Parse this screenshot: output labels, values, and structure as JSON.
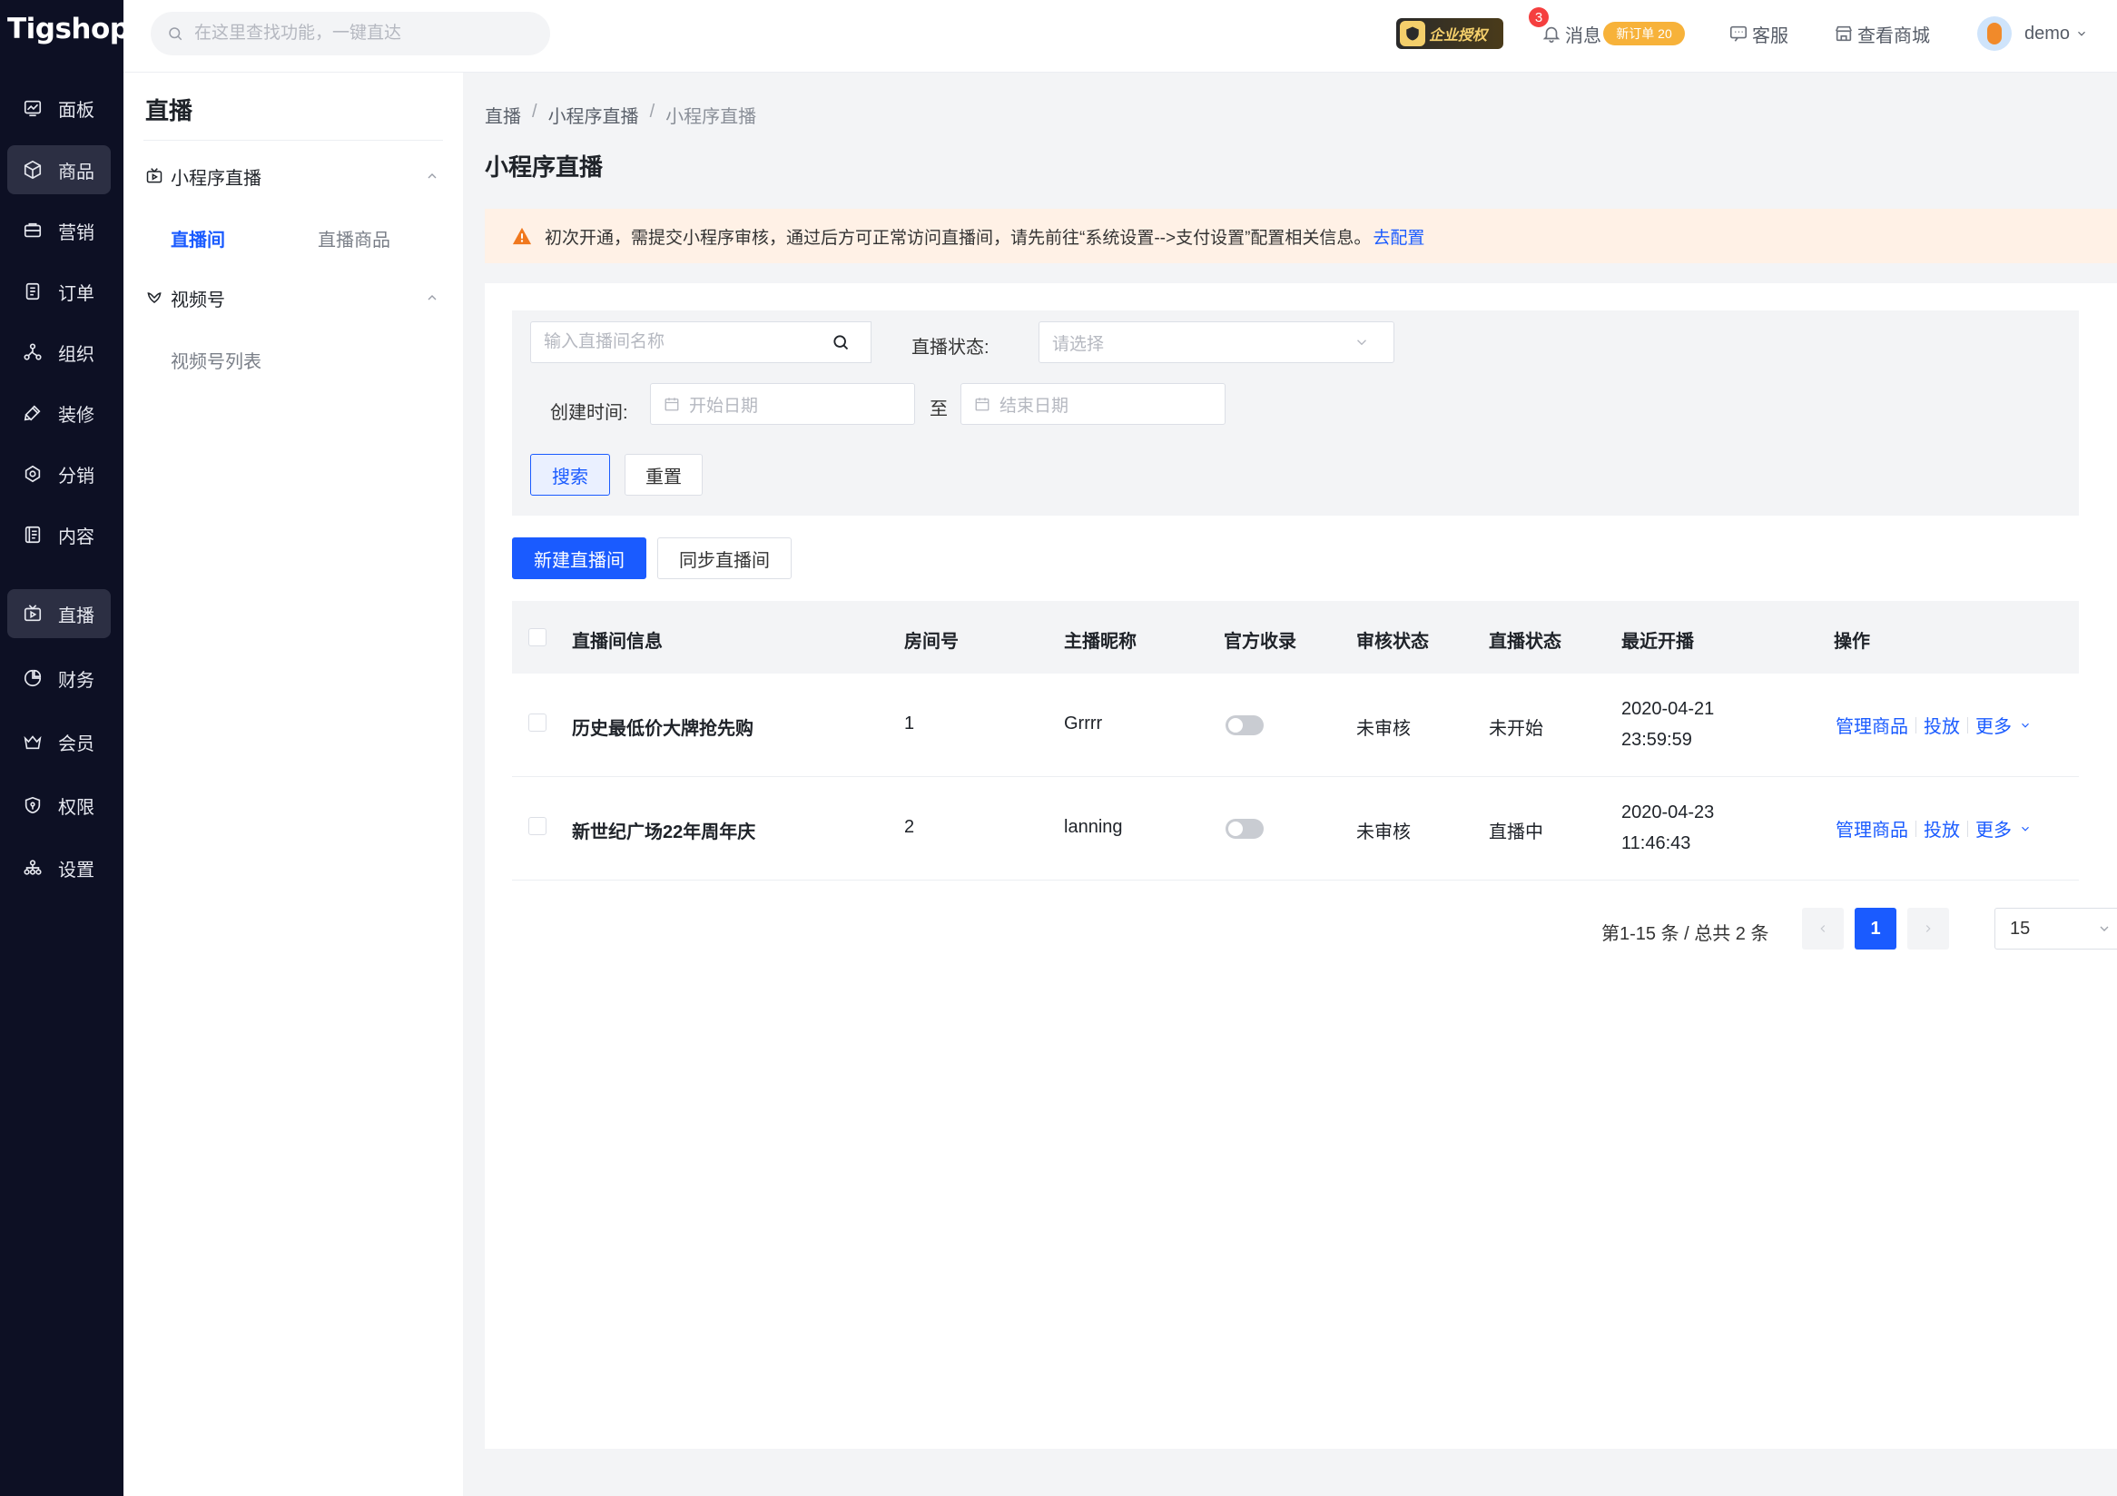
{
  "app": {
    "logo": "Tigshop"
  },
  "nav": {
    "items": [
      {
        "label": "面板",
        "icon": "dashboard-icon"
      },
      {
        "label": "商品",
        "icon": "box-icon",
        "active": true
      },
      {
        "label": "营销",
        "icon": "marketing-icon"
      },
      {
        "label": "订单",
        "icon": "order-icon"
      },
      {
        "label": "组织",
        "icon": "organization-icon"
      },
      {
        "label": "装修",
        "icon": "paint-icon"
      },
      {
        "label": "分销",
        "icon": "distribution-icon"
      },
      {
        "label": "内容",
        "icon": "content-icon"
      },
      {
        "label": "直播",
        "icon": "live-icon",
        "active": true
      },
      {
        "label": "财务",
        "icon": "finance-icon"
      },
      {
        "label": "会员",
        "icon": "member-icon"
      },
      {
        "label": "权限",
        "icon": "permission-icon"
      },
      {
        "label": "设置",
        "icon": "settings-icon"
      }
    ]
  },
  "topbar": {
    "search_placeholder": "在这里查找功能，一键直达",
    "auth_badge": "企业授权",
    "message_label": "消息",
    "message_count": "3",
    "new_order_pill": "新订单 20",
    "service_label": "客服",
    "view_store_label": "查看商城",
    "user_name": "demo"
  },
  "sub_sidebar": {
    "title": "直播",
    "groups": [
      {
        "label": "小程序直播",
        "items": [
          {
            "label": "直播间",
            "active": true
          },
          {
            "label": "直播商品"
          }
        ]
      },
      {
        "label": "视频号",
        "items": [
          {
            "label": "视频号列表"
          }
        ]
      }
    ]
  },
  "main": {
    "breadcrumb": [
      "直播",
      "小程序直播",
      "小程序直播"
    ],
    "title": "小程序直播",
    "alert": {
      "text": "初次开通，需提交小程序审核，通过后方可正常访问直播间，请先前往“系统设置-->支付设置”配置相关信息。",
      "link": "去配置"
    },
    "filter": {
      "name_placeholder": "输入直播间名称",
      "status_label": "直播状态:",
      "status_placeholder": "请选择",
      "created_label": "创建时间:",
      "start_placeholder": "开始日期",
      "to_label": "至",
      "end_placeholder": "结束日期",
      "search_btn": "搜索",
      "reset_btn": "重置"
    },
    "actions": {
      "create": "新建直播间",
      "sync": "同步直播间"
    },
    "table": {
      "headers": [
        "直播间信息",
        "房间号",
        "主播昵称",
        "官方收录",
        "审核状态",
        "直播状态",
        "最近开播",
        "操作"
      ],
      "rows": [
        {
          "name": "历史最低价大牌抢先购",
          "room": "1",
          "anchor": "Grrrr",
          "official": false,
          "review": "未审核",
          "status": "未开始",
          "date": "2020-04-21",
          "time": "23:59:59"
        },
        {
          "name": "新世纪广场22年周年庆",
          "room": "2",
          "anchor": "lanning",
          "official": false,
          "review": "未审核",
          "status": "直播中",
          "date": "2020-04-23",
          "time": "11:46:43"
        }
      ],
      "ops": {
        "manage": "管理商品",
        "deliver": "投放",
        "more": "更多"
      }
    },
    "pagination": {
      "summary": "第1-15 条 / 总共 2 条",
      "current": "1",
      "page_size": "15"
    }
  },
  "colors": {
    "primary": "#1a5bff",
    "nav_bg": "#0d1024",
    "alert_bg": "#fff1e6",
    "warn": "#f0781e"
  }
}
